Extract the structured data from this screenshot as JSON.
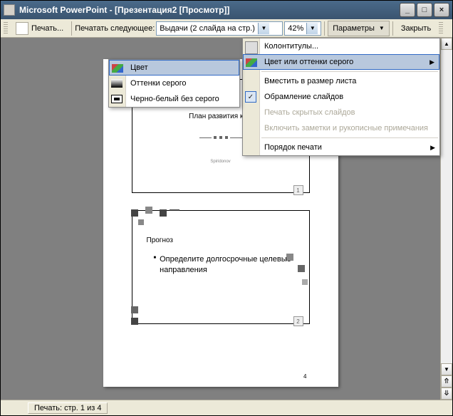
{
  "titlebar": {
    "title": "Microsoft PowerPoint - [Презентация2 [Просмотр]]"
  },
  "toolbar": {
    "print_label": "Печать...",
    "print_what_label": "Печатать следующее:",
    "print_what_value": "Выдачи (2 слайда на стр.)",
    "zoom_value": "42%",
    "params_label": "Параметры",
    "close_label": "Закрыть"
  },
  "color_submenu": {
    "items": [
      {
        "label": "Цвет",
        "kind": "color"
      },
      {
        "label": "Оттенки серого",
        "kind": "gray"
      },
      {
        "label": "Черно-белый без серого",
        "kind": "bw"
      }
    ]
  },
  "params_menu": {
    "headers_footers": "Колонтитулы...",
    "color_grayscale": "Цвет или оттенки серого",
    "fit_to_window": "Вместить в размер листа",
    "frame_slides": "Обрамление слайдов",
    "print_hidden": "Печать скрытых слайдов",
    "include_notes": "Включить заметки и рукописные примечания",
    "print_order": "Порядок печати"
  },
  "preview": {
    "slide1_title": "План развития ком",
    "slide1_footer": "Spiridonov",
    "slide1_pagenum": "1",
    "slide2_title": "Прогноз",
    "slide2_bullet": "Определите долгосрочные целевые направления",
    "slide2_pagenum": "2",
    "page_total_num": "4"
  },
  "statusbar": {
    "text": "Печать: стр. 1 из 4"
  }
}
